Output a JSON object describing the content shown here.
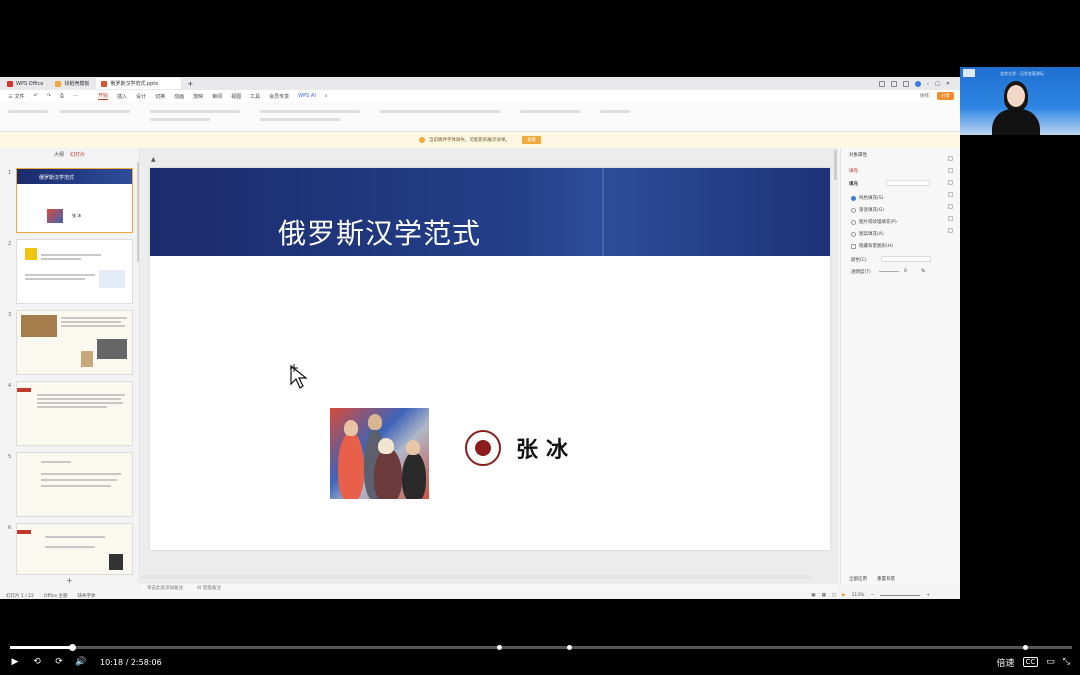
{
  "tabs": [
    {
      "label": "WPS Office",
      "color": "#d9342b"
    },
    {
      "label": "找稻壳模板",
      "color": "#f0a93b"
    },
    {
      "label": "俄罗斯汉学范式.pptx",
      "color": "#d9542b"
    }
  ],
  "menu": {
    "file": "三 文件",
    "items": [
      "开始",
      "插入",
      "设计",
      "切换",
      "动画",
      "放映",
      "审阅",
      "视图",
      "工具",
      "会员专享",
      "WPS AI"
    ],
    "active": "开始",
    "share": "分享",
    "collab": "协作"
  },
  "notice": {
    "text": "当前稿件字体缺失，可能影响展示效果。",
    "button": "查看"
  },
  "thumbs": {
    "tab_outline": "大纲",
    "tab_slides": "幻灯片",
    "count": [
      "1",
      "2",
      "3",
      "4",
      "5",
      "6"
    ],
    "slide1_title": "俄罗斯汉学范式",
    "slide1_author": "张 冰"
  },
  "slide": {
    "title": "俄罗斯汉学范式",
    "author": "张冰"
  },
  "props": {
    "header": "对象属性",
    "tab_fill": "填充",
    "section": "填充",
    "options": [
      "纯色填充(S)",
      "渐变填充(G)",
      "图片或纹理填充(P)",
      "图案填充(A)",
      "隐藏背景图形(H)"
    ],
    "label_fill": "颜色(C)",
    "label_transparency": "透明度(T)",
    "transparency_value": "0",
    "tab_all": "全部应用",
    "tab_reset": "重置背景"
  },
  "notes": {
    "placeholder": "单击此处添加备注",
    "ai": "AI 智能备注"
  },
  "status": {
    "slide": "幻灯片 1 / 22",
    "theme": "Office 主题",
    "font": "缺失字体",
    "zoom": "113%"
  },
  "webcam": {
    "caption": "北京大学 · 汉学名家讲坛"
  },
  "video": {
    "current": "10:18",
    "total": "2:58:06",
    "played_fraction": 0.058,
    "speed": "倍速"
  }
}
